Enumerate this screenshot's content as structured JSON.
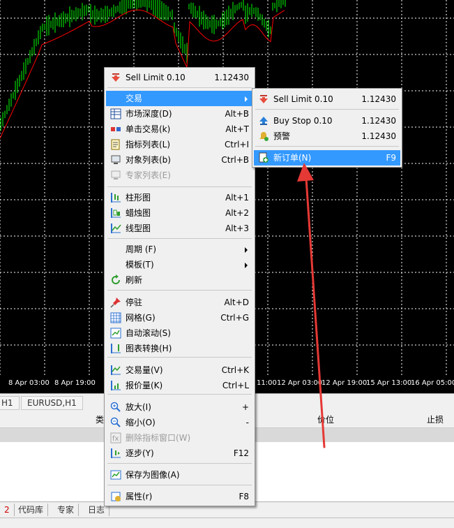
{
  "chart": {
    "x_axis_labels": [
      "8 Apr 03:00",
      "8 Apr 19:00",
      "11:00",
      "12 Apr 03:00",
      "12 Apr 19:00",
      "15 Apr 13:00",
      "16 Apr 05:00"
    ],
    "colors": {
      "background": "#000000",
      "bars": "#00ff00",
      "moving_average": "#ff0000",
      "grid": "#ffffff"
    }
  },
  "chart_tabs": [
    "H1",
    "EURUSD,H1"
  ],
  "terminal": {
    "columns": [
      "类",
      "价位",
      "止损"
    ]
  },
  "bottom_tabs": [
    "2",
    "代码库",
    "专家",
    "日志"
  ],
  "context_menu": {
    "items": [
      {
        "icon": "sell-arrow-icon",
        "label": "Sell Limit 0.10",
        "shortcut": "1.12430"
      },
      {
        "icon": "",
        "label": "交易",
        "shortcut": "",
        "submenu": true,
        "highlighted": true
      },
      {
        "icon": "market-depth-icon",
        "label": "市场深度(D)",
        "shortcut": "Alt+B"
      },
      {
        "icon": "one-click-trading-icon",
        "label": "单击交易(k)",
        "shortcut": "Alt+T"
      },
      {
        "icon": "indicators-list-icon",
        "label": "指标列表(L)",
        "shortcut": "Ctrl+I"
      },
      {
        "icon": "objects-list-icon",
        "label": "对象列表(b)",
        "shortcut": "Ctrl+B"
      },
      {
        "icon": "experts-list-icon",
        "label": "专家列表(E)",
        "shortcut": "",
        "disabled": true
      },
      {
        "icon": "bar-chart-icon",
        "label": "柱形图",
        "shortcut": "Alt+1"
      },
      {
        "icon": "candlestick-icon",
        "label": "蜡烛图",
        "shortcut": "Alt+2"
      },
      {
        "icon": "line-chart-icon",
        "label": "线型图",
        "shortcut": "Alt+3"
      },
      {
        "icon": "",
        "label": "周期 (F)",
        "shortcut": "",
        "submenu": true
      },
      {
        "icon": "",
        "label": "模板(T)",
        "shortcut": "",
        "submenu": true
      },
      {
        "icon": "refresh-icon",
        "label": "刷新",
        "shortcut": ""
      },
      {
        "icon": "pin-icon",
        "label": "停驻",
        "shortcut": "Alt+D"
      },
      {
        "icon": "grid-icon",
        "label": "网格(G)",
        "shortcut": "Ctrl+G"
      },
      {
        "icon": "autoscroll-icon",
        "label": "自动滚动(S)",
        "shortcut": ""
      },
      {
        "icon": "chart-shift-icon",
        "label": "图表转换(H)",
        "shortcut": ""
      },
      {
        "icon": "volume-icon",
        "label": "交易量(V)",
        "shortcut": "Ctrl+K"
      },
      {
        "icon": "quote-price-icon",
        "label": "报价量(K)",
        "shortcut": "Ctrl+L"
      },
      {
        "icon": "zoom-in-icon",
        "label": "放大(I)",
        "shortcut": "+"
      },
      {
        "icon": "zoom-out-icon",
        "label": "缩小(O)",
        "shortcut": "-"
      },
      {
        "icon": "delete-indicator-window-icon",
        "label": "删除指标窗口(W)",
        "shortcut": "",
        "disabled": true
      },
      {
        "icon": "step-icon",
        "label": "逐步(Y)",
        "shortcut": "F12"
      },
      {
        "icon": "save-image-icon",
        "label": "保存为图像(A)",
        "shortcut": ""
      },
      {
        "icon": "properties-icon",
        "label": "属性(r)",
        "shortcut": "F8"
      }
    ]
  },
  "trade_submenu": {
    "items": [
      {
        "icon": "sell-arrow-icon",
        "label": "Sell Limit 0.10",
        "shortcut": "1.12430"
      },
      {
        "icon": "buy-arrow-icon",
        "label": "Buy Stop 0.10",
        "shortcut": "1.12430"
      },
      {
        "icon": "alert-bell-icon",
        "label": "预警",
        "shortcut": "1.12430"
      },
      {
        "icon": "new-order-icon",
        "label": "新订单(N)",
        "shortcut": "F9",
        "highlighted": true
      }
    ]
  },
  "annotation": {
    "arrow_color": "#e53935"
  }
}
